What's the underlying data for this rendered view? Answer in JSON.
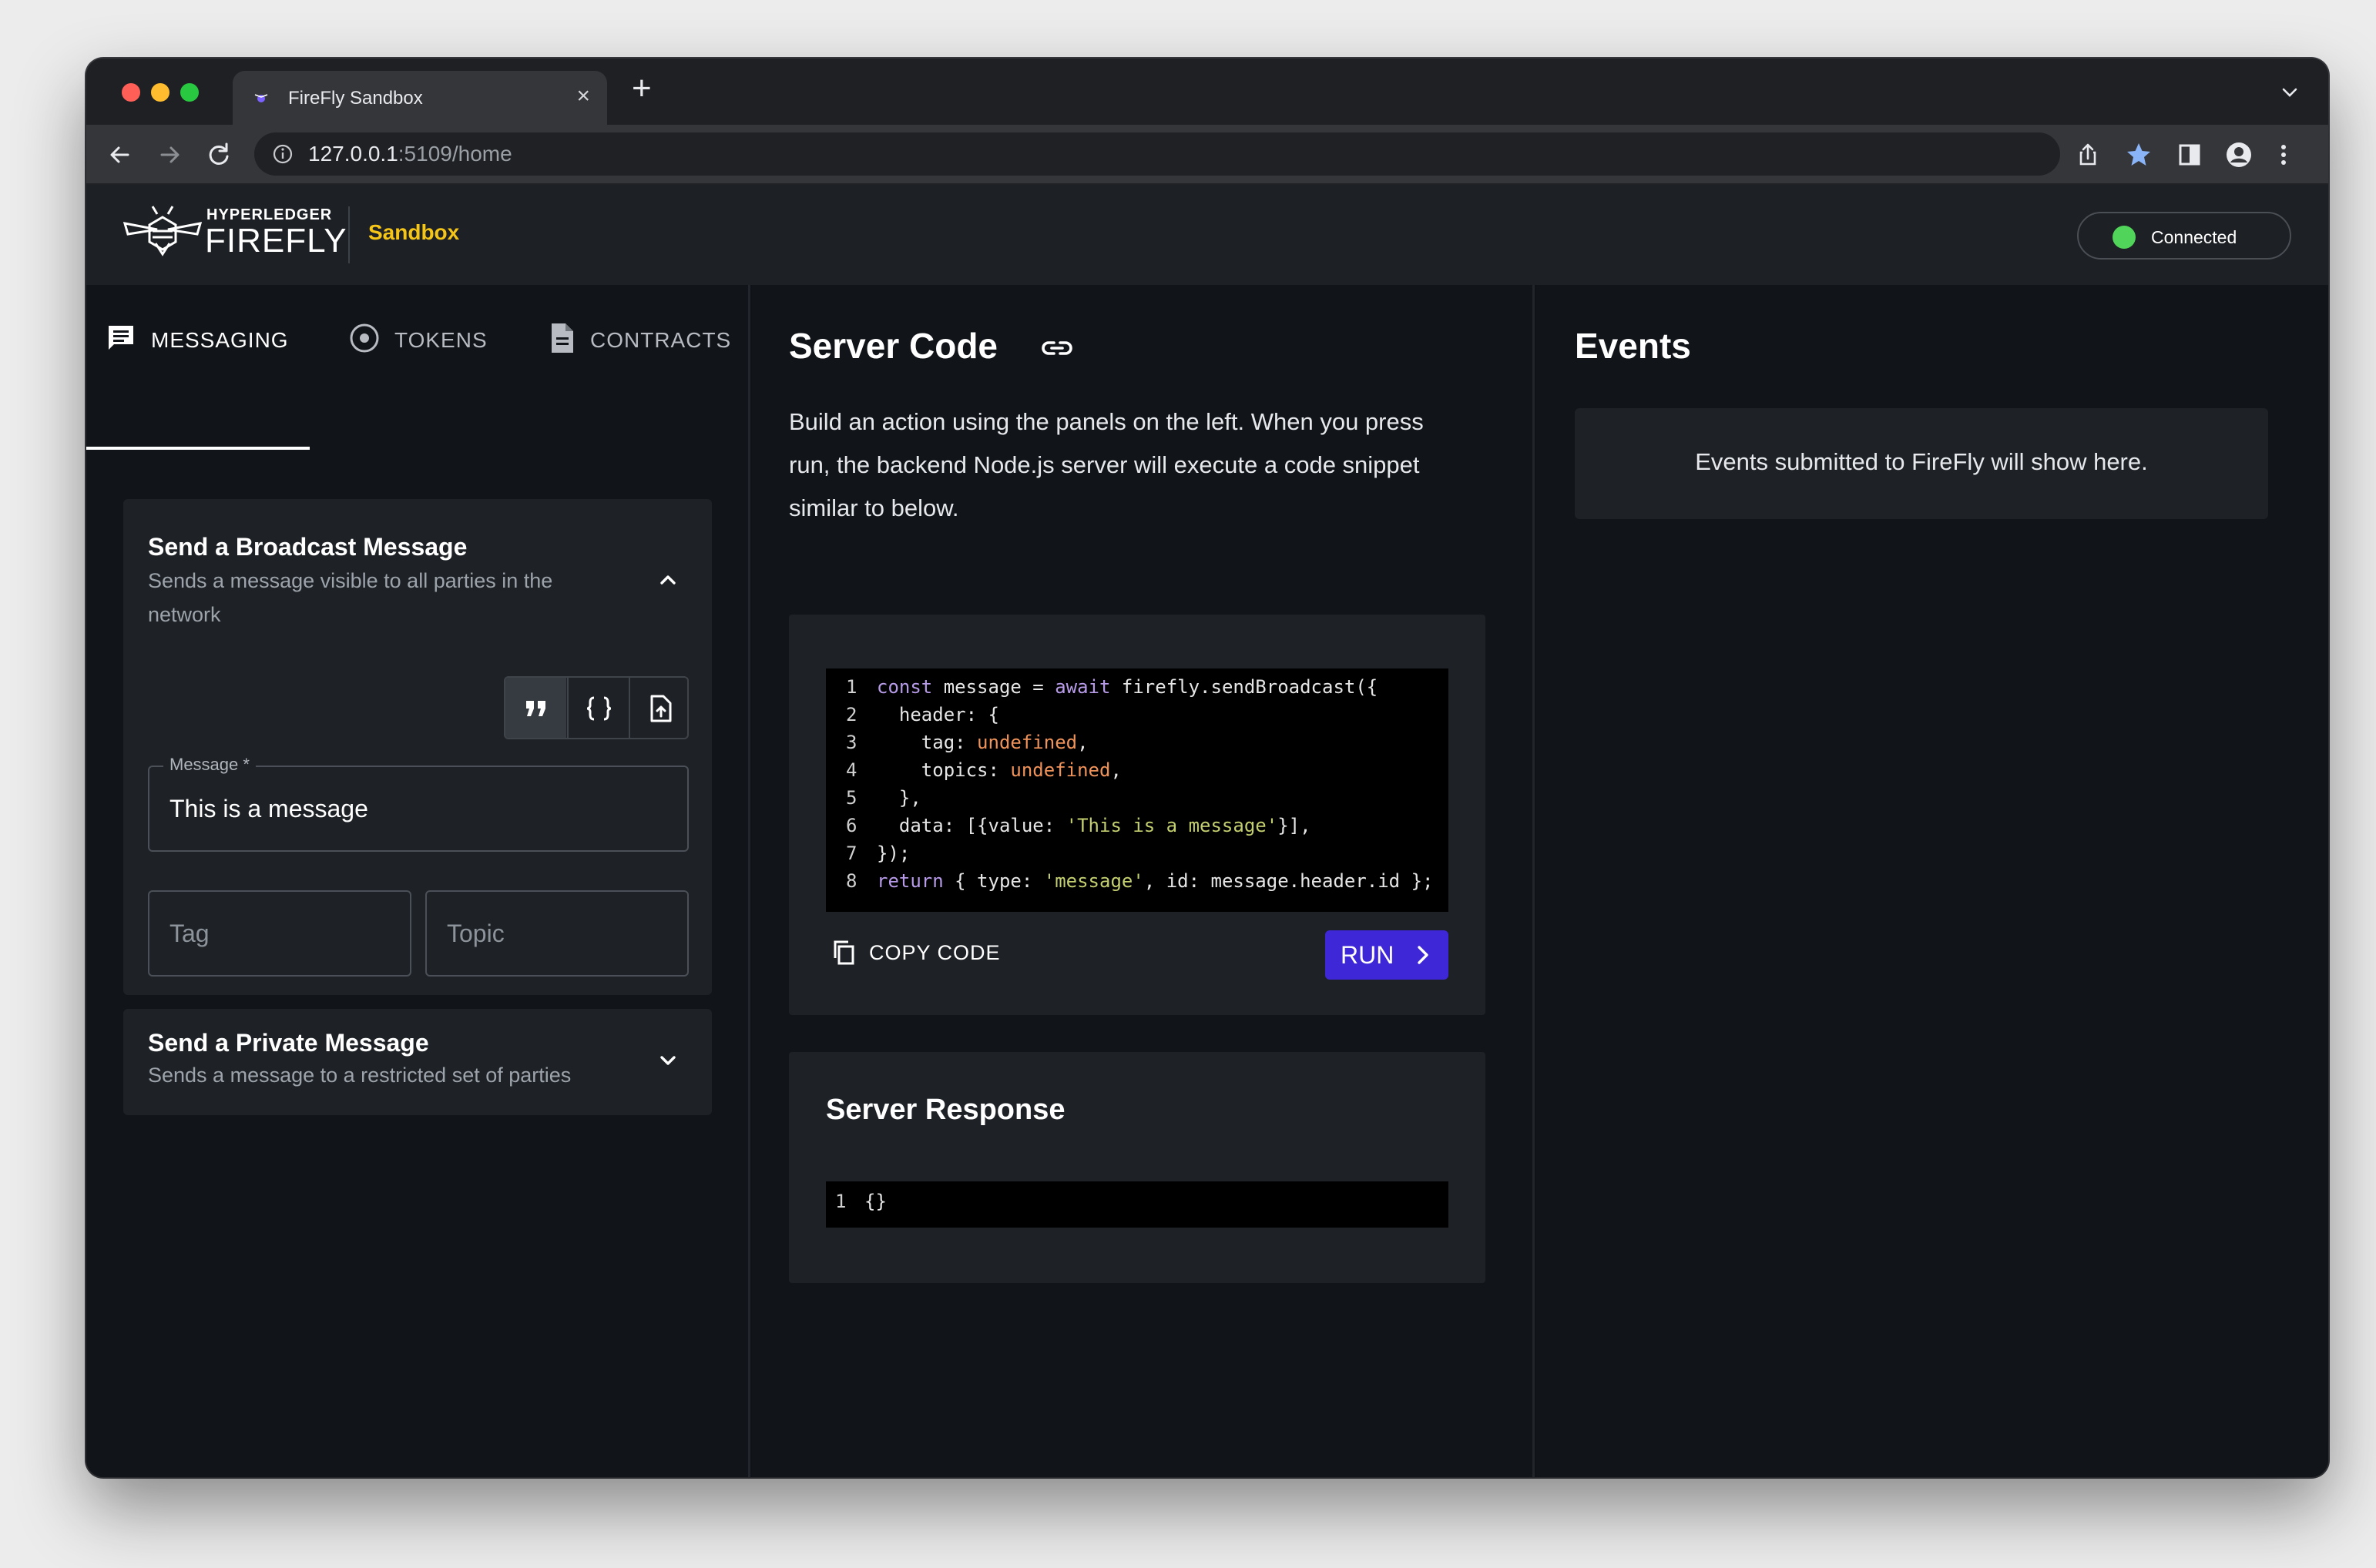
{
  "browser": {
    "tab_title": "FireFly Sandbox",
    "url_host": "127.0.0.1",
    "url_rest": ":5109/home"
  },
  "header": {
    "brand_top": "HYPERLEDGER",
    "brand_main": "FIREFLY",
    "product": "Sandbox",
    "status": "Connected"
  },
  "nav": {
    "tabs": [
      {
        "label": "MESSAGING"
      },
      {
        "label": "TOKENS"
      },
      {
        "label": "CONTRACTS"
      }
    ]
  },
  "broadcast": {
    "title": "Send a Broadcast Message",
    "subtitle_1": "Sends a message visible to all parties in the",
    "subtitle_2": "network",
    "message_label": "Message *",
    "message_value": "This is a message",
    "tag_placeholder": "Tag",
    "topic_placeholder": "Topic"
  },
  "private": {
    "title": "Send a Private Message",
    "subtitle": "Sends a message to a restricted set of parties"
  },
  "server_code": {
    "title": "Server Code",
    "description_1": "Build an action using the panels on the left. When you press",
    "description_2": "run, the backend Node.js server will execute a code snippet",
    "description_3": "similar to below.",
    "line_numbers": [
      "1",
      "2",
      "3",
      "4",
      "5",
      "6",
      "7",
      "8"
    ],
    "copy_label": "COPY CODE",
    "run_label": "RUN"
  },
  "server_response": {
    "title": "Server Response",
    "line_number": "1",
    "body": "{}"
  },
  "events": {
    "title": "Events",
    "empty_message": "Events submitted to FireFly will show here."
  },
  "colors": {
    "accent_yellow": "#f5c518",
    "run_button": "#3e27d6",
    "connected_green": "#50d45a",
    "panel_bg": "#1e2227",
    "page_bg": "#111419"
  }
}
